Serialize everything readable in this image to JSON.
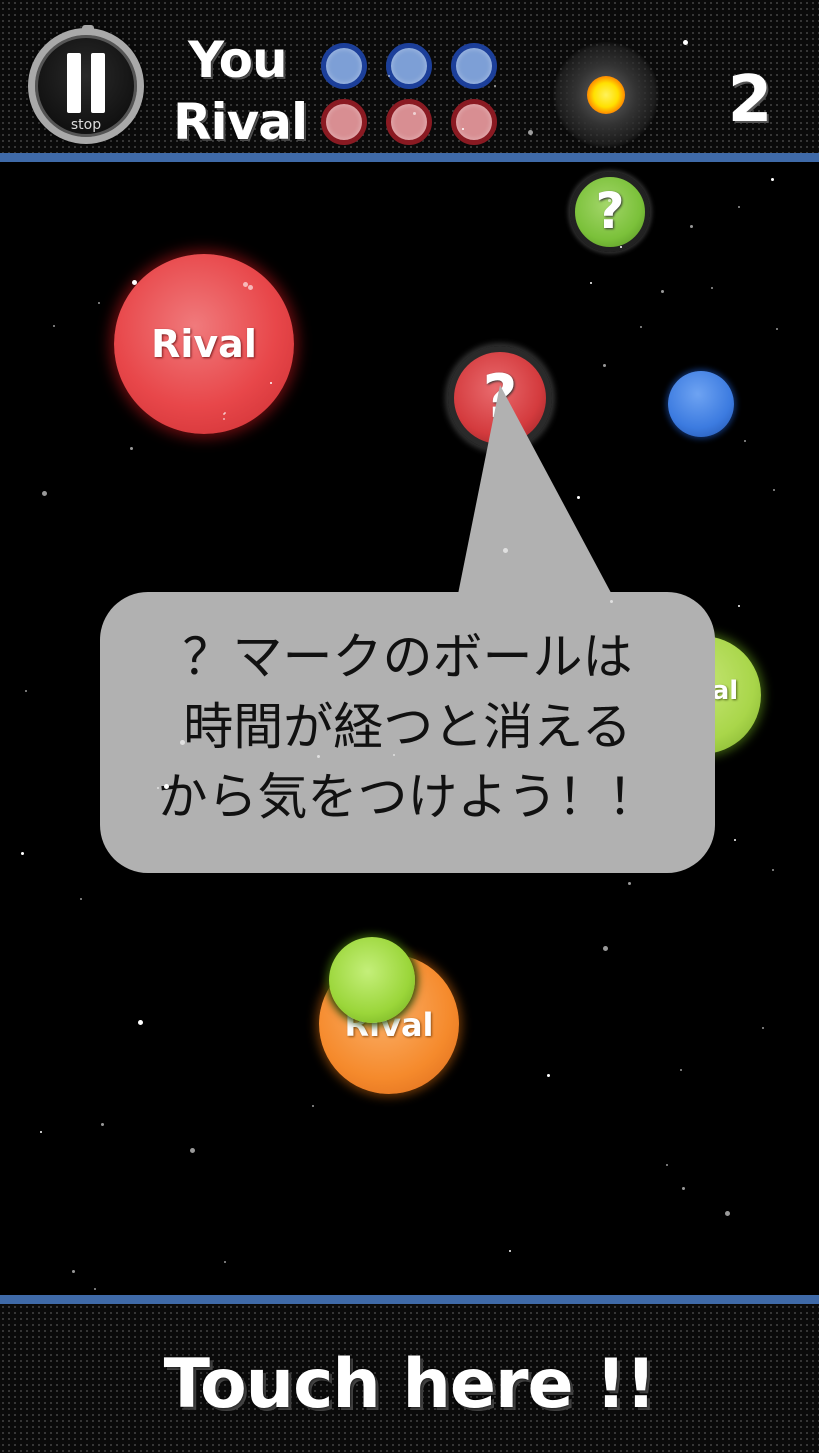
{
  "header": {
    "pause_button": {
      "label": "stop",
      "icon": "pause-icon"
    },
    "you_label": "You",
    "rival_label": "Rival",
    "you_lives": 3,
    "rival_lives": 3,
    "score": "2"
  },
  "field": {
    "balls": [
      {
        "id": "rival-ball-large",
        "label": "Rival",
        "color": "#e83b3e",
        "kind": "rival"
      },
      {
        "id": "question-ball-green",
        "label": "?",
        "color": "#7bc13a",
        "kind": "question"
      },
      {
        "id": "question-ball-red",
        "label": "?",
        "color": "#d43b3e",
        "kind": "question"
      },
      {
        "id": "blue-ball",
        "label": "",
        "color": "#3c7be0",
        "kind": "player"
      },
      {
        "id": "rival-ball-green",
        "label": "Rival",
        "color": "#a9d64a",
        "kind": "rival"
      },
      {
        "id": "green-ball-faded",
        "label": "",
        "color": "#b7d98f",
        "kind": "plain"
      },
      {
        "id": "rival-ball-orange",
        "label": "Rival",
        "color": "#f58a2c",
        "kind": "rival"
      },
      {
        "id": "green-ball-small",
        "label": "",
        "color": "#9bd63a",
        "kind": "plain"
      }
    ]
  },
  "tooltip": {
    "lines": [
      "？マークのボールは",
      "時間が経つと消える",
      "から気をつけよう！！"
    ]
  },
  "footer": {
    "touch_label": "Touch here !!"
  },
  "colors": {
    "accent_bar": "#3f6aa8",
    "you": "#7d9fd6",
    "rival": "#d88e92",
    "bubble": "#b1b1b1"
  }
}
